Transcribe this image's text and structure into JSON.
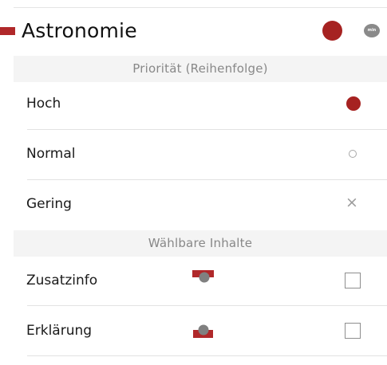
{
  "header": {
    "title": "Astronomie",
    "min_label": "min"
  },
  "sections": {
    "priority_title": "Priorität (Reihenfolge)",
    "content_title": "Wählbare Inhalte"
  },
  "priority_rows": [
    {
      "label": "Hoch",
      "selected": true
    },
    {
      "label": "Normal",
      "selected": false
    },
    {
      "label": "Gering",
      "selected": false
    }
  ],
  "content_rows": [
    {
      "label": "Zusatzinfo",
      "checked": false
    },
    {
      "label": "Erklärung",
      "checked": false
    }
  ],
  "icons": {
    "hoch": "filled-dot-icon",
    "normal": "ring-icon",
    "gering": "x-icon",
    "zusatzinfo": "top-bar-dot-icon",
    "erklaerung": "bottom-bar-dot-icon"
  },
  "colors": {
    "accent": "#a62221",
    "section_bg": "#f4f4f4",
    "section_text": "#888888"
  }
}
